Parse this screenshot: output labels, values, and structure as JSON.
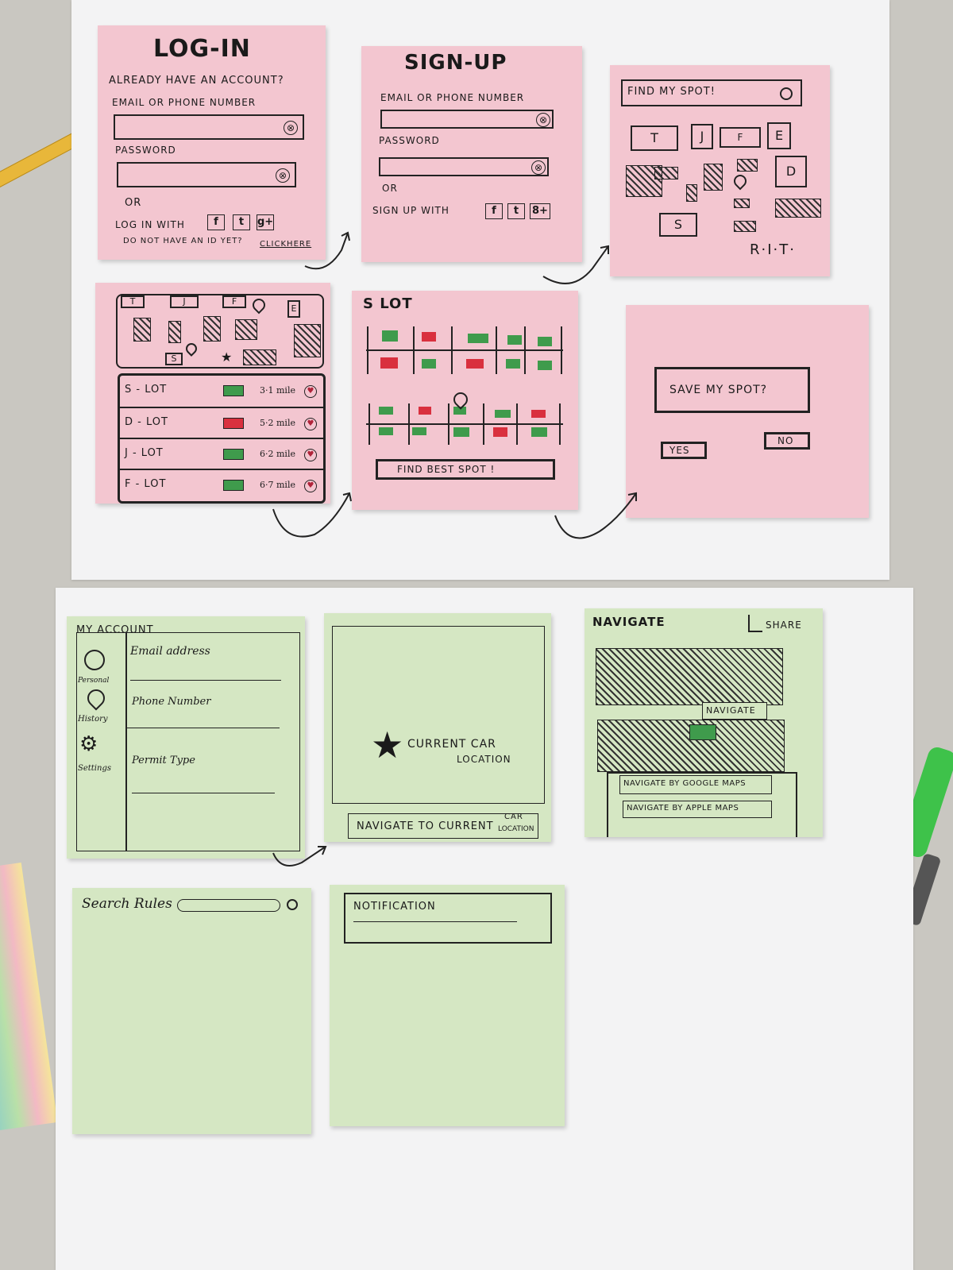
{
  "login": {
    "title": "LOG-IN",
    "already": "ALREADY HAVE AN ACCOUNT?",
    "email_label": "EMAIL OR PHONE NUMBER",
    "password_label": "PASSWORD",
    "or": "OR",
    "login_with": "LOG IN WITH",
    "no_id": "DO NOT HAVE AN ID YET?",
    "click_here": "CLICKHERE"
  },
  "signup": {
    "title": "SIGN-UP",
    "email_label": "EMAIL OR PHONE NUMBER",
    "password_label": "PASSWORD",
    "or": "OR",
    "signup_with": "SIGN UP WITH"
  },
  "social": {
    "facebook": "f",
    "twitter": "t",
    "google": "g+",
    "google_alt": "8+"
  },
  "clear_glyph": "⊗",
  "findspot": {
    "search_placeholder": "FIND MY SPOT!",
    "buildings": [
      "T",
      "J",
      "F",
      "E",
      "D",
      "S"
    ],
    "campus": "R·I·T·"
  },
  "lotmap": {
    "buildings": [
      "T",
      "J",
      "F",
      "E",
      "S"
    ],
    "lots": [
      {
        "name": "S - LOT",
        "distance": "3·1 mile",
        "status": "green"
      },
      {
        "name": "D - LOT",
        "distance": "5·2 mile",
        "status": "red"
      },
      {
        "name": "J - LOT",
        "distance": "6·2 mile",
        "status": "green"
      },
      {
        "name": "F - LOT",
        "distance": "6·7 mile",
        "status": "green"
      }
    ]
  },
  "slot": {
    "title": "S LOT",
    "find_best": "FIND BEST SPOT !"
  },
  "save": {
    "question": "SAVE MY SPOT?",
    "yes": "YES",
    "no": "NO"
  },
  "account": {
    "title": "MY ACCOUNT",
    "side": [
      "Personal",
      "History",
      "Settings"
    ],
    "fields": [
      "Email address",
      "Phone Number",
      "Permit Type"
    ]
  },
  "carloc": {
    "label_line1": "CURRENT CAR",
    "label_line2": "LOCATION",
    "nav_button_main": "NAVIGATE TO CURRENT",
    "nav_button_top": "CAR",
    "nav_button_bottom": "LOCATION"
  },
  "navigate": {
    "title": "NAVIGATE",
    "share": "SHARE",
    "pin_label": "NAVIGATE",
    "google": "NAVIGATE BY GOOGLE MAPS",
    "apple": "NAVIGATE BY APPLE MAPS"
  },
  "rules": {
    "label": "Search Rules"
  },
  "notification": {
    "title": "NOTIFICATION"
  },
  "colors": {
    "pink_note": "#f3c6d0",
    "green_note": "#d5e7c3",
    "lot_green": "#3f9b4c",
    "lot_red": "#d9303e"
  }
}
